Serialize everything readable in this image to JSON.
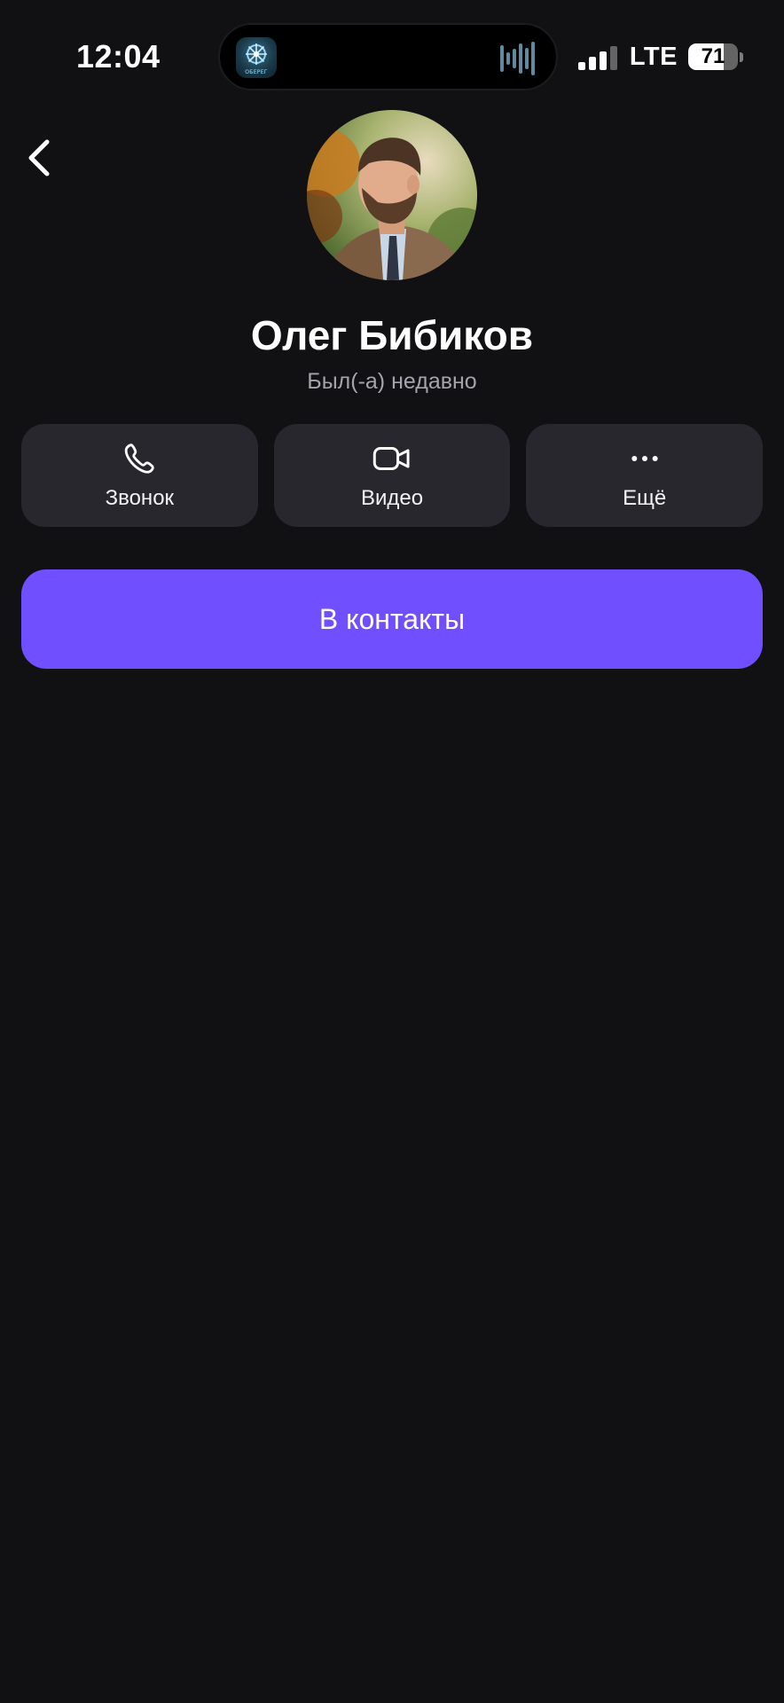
{
  "status_bar": {
    "time": "12:04",
    "network": "LTE",
    "battery_level": "71",
    "battery_fraction": 0.71,
    "signal_bars_active": 3,
    "signal_bars_total": 4,
    "island_app_caption": "ОБЕРЕГ",
    "icons": {
      "signal": "cellular-signal-icon",
      "battery": "battery-icon",
      "island_app": "app-icon",
      "island_activity": "audio-wave-icon"
    }
  },
  "header": {
    "back_icon": "chevron-left-icon",
    "avatar": "profile-photo"
  },
  "profile": {
    "name": "Олег Бибиков",
    "status": "Был(-а) недавно"
  },
  "actions": [
    {
      "label": "Звонок",
      "icon": "phone-icon"
    },
    {
      "label": "Видео",
      "icon": "video-camera-icon"
    },
    {
      "label": "Ещё",
      "icon": "more-dots-icon"
    }
  ],
  "primary_action": {
    "label": "В контакты"
  },
  "colors": {
    "background": "#111113",
    "card": "#28272d",
    "accent": "#6f4fff",
    "secondary_text": "#a4a4aa"
  }
}
